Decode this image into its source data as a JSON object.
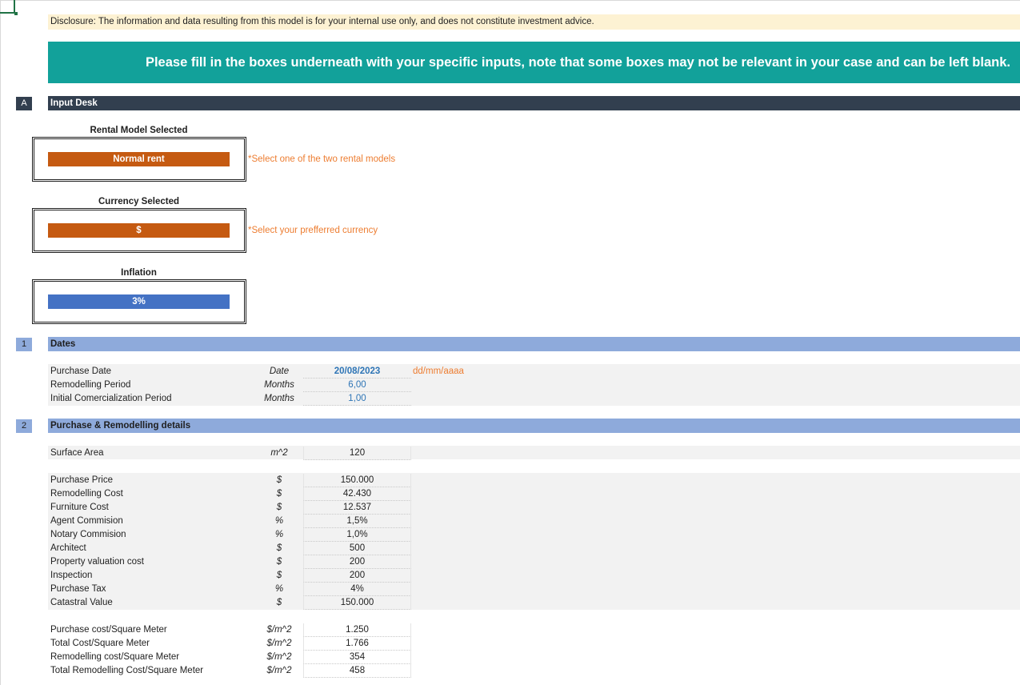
{
  "disclosure": "Disclosure: The information and data resulting from this model is for your internal use only, and does not constitute investment advice.",
  "banner": "Please fill in the boxes underneath with your specific inputs, note that some boxes may not be relevant in your case and can be left blank.",
  "section_a": {
    "marker": "A",
    "title": "Input Desk"
  },
  "rental_model": {
    "label": "Rental Model Selected",
    "value": "Normal rent",
    "note": "*Select one of the two rental models"
  },
  "currency": {
    "label": "Currency  Selected",
    "value": "$",
    "note": "*Select your prefferred currency"
  },
  "inflation": {
    "label": "Inflation",
    "value": "3%"
  },
  "section_1": {
    "marker": "1",
    "title": "Dates",
    "rows": [
      {
        "label": "Purchase Date",
        "unit": "Date",
        "value": "20/08/2023",
        "hint": "dd/mm/aaaa"
      },
      {
        "label": "Remodelling Period",
        "unit": "Months",
        "value": "6,00"
      },
      {
        "label": "Initial Comercialization Period",
        "unit": "Months",
        "value": "1,00"
      }
    ]
  },
  "section_2": {
    "marker": "2",
    "title": "Purchase & Remodelling details",
    "surface": {
      "label": "Surface Area",
      "unit": "m^2",
      "value": "120"
    },
    "costs": [
      {
        "label": "Purchase Price",
        "unit": "$",
        "value": "150.000"
      },
      {
        "label": "Remodelling Cost",
        "unit": "$",
        "value": "42.430"
      },
      {
        "label": "Furniture Cost",
        "unit": "$",
        "value": "12.537"
      },
      {
        "label": "Agent Commision",
        "unit": "%",
        "value": "1,5%"
      },
      {
        "label": "Notary Commision",
        "unit": "%",
        "value": "1,0%"
      },
      {
        "label": "Architect",
        "unit": "$",
        "value": "500"
      },
      {
        "label": "Property valuation cost",
        "unit": "$",
        "value": "200"
      },
      {
        "label": "Inspection",
        "unit": "$",
        "value": "200"
      },
      {
        "label": "Purchase Tax",
        "unit": "%",
        "value": "4%"
      },
      {
        "label": "Catastral Value",
        "unit": "$",
        "value": "150.000"
      }
    ],
    "per_sqm": [
      {
        "label": "Purchase cost/Square Meter",
        "unit": "$/m^2",
        "value": "1.250"
      },
      {
        "label": "Total Cost/Square Meter",
        "unit": "$/m^2",
        "value": "1.766"
      },
      {
        "label": "Remodelling cost/Square Meter",
        "unit": "$/m^2",
        "value": "354"
      },
      {
        "label": "Total Remodelling Cost/Square Meter",
        "unit": "$/m^2",
        "value": "458"
      }
    ]
  },
  "colors": {
    "teal": "#12a19a",
    "navy": "#323f4f",
    "section_blue": "#8eaadb",
    "orange": "#c55a11",
    "blue": "#4472c4",
    "note_orange": "#ed7d31",
    "value_blue": "#2e75b6"
  }
}
